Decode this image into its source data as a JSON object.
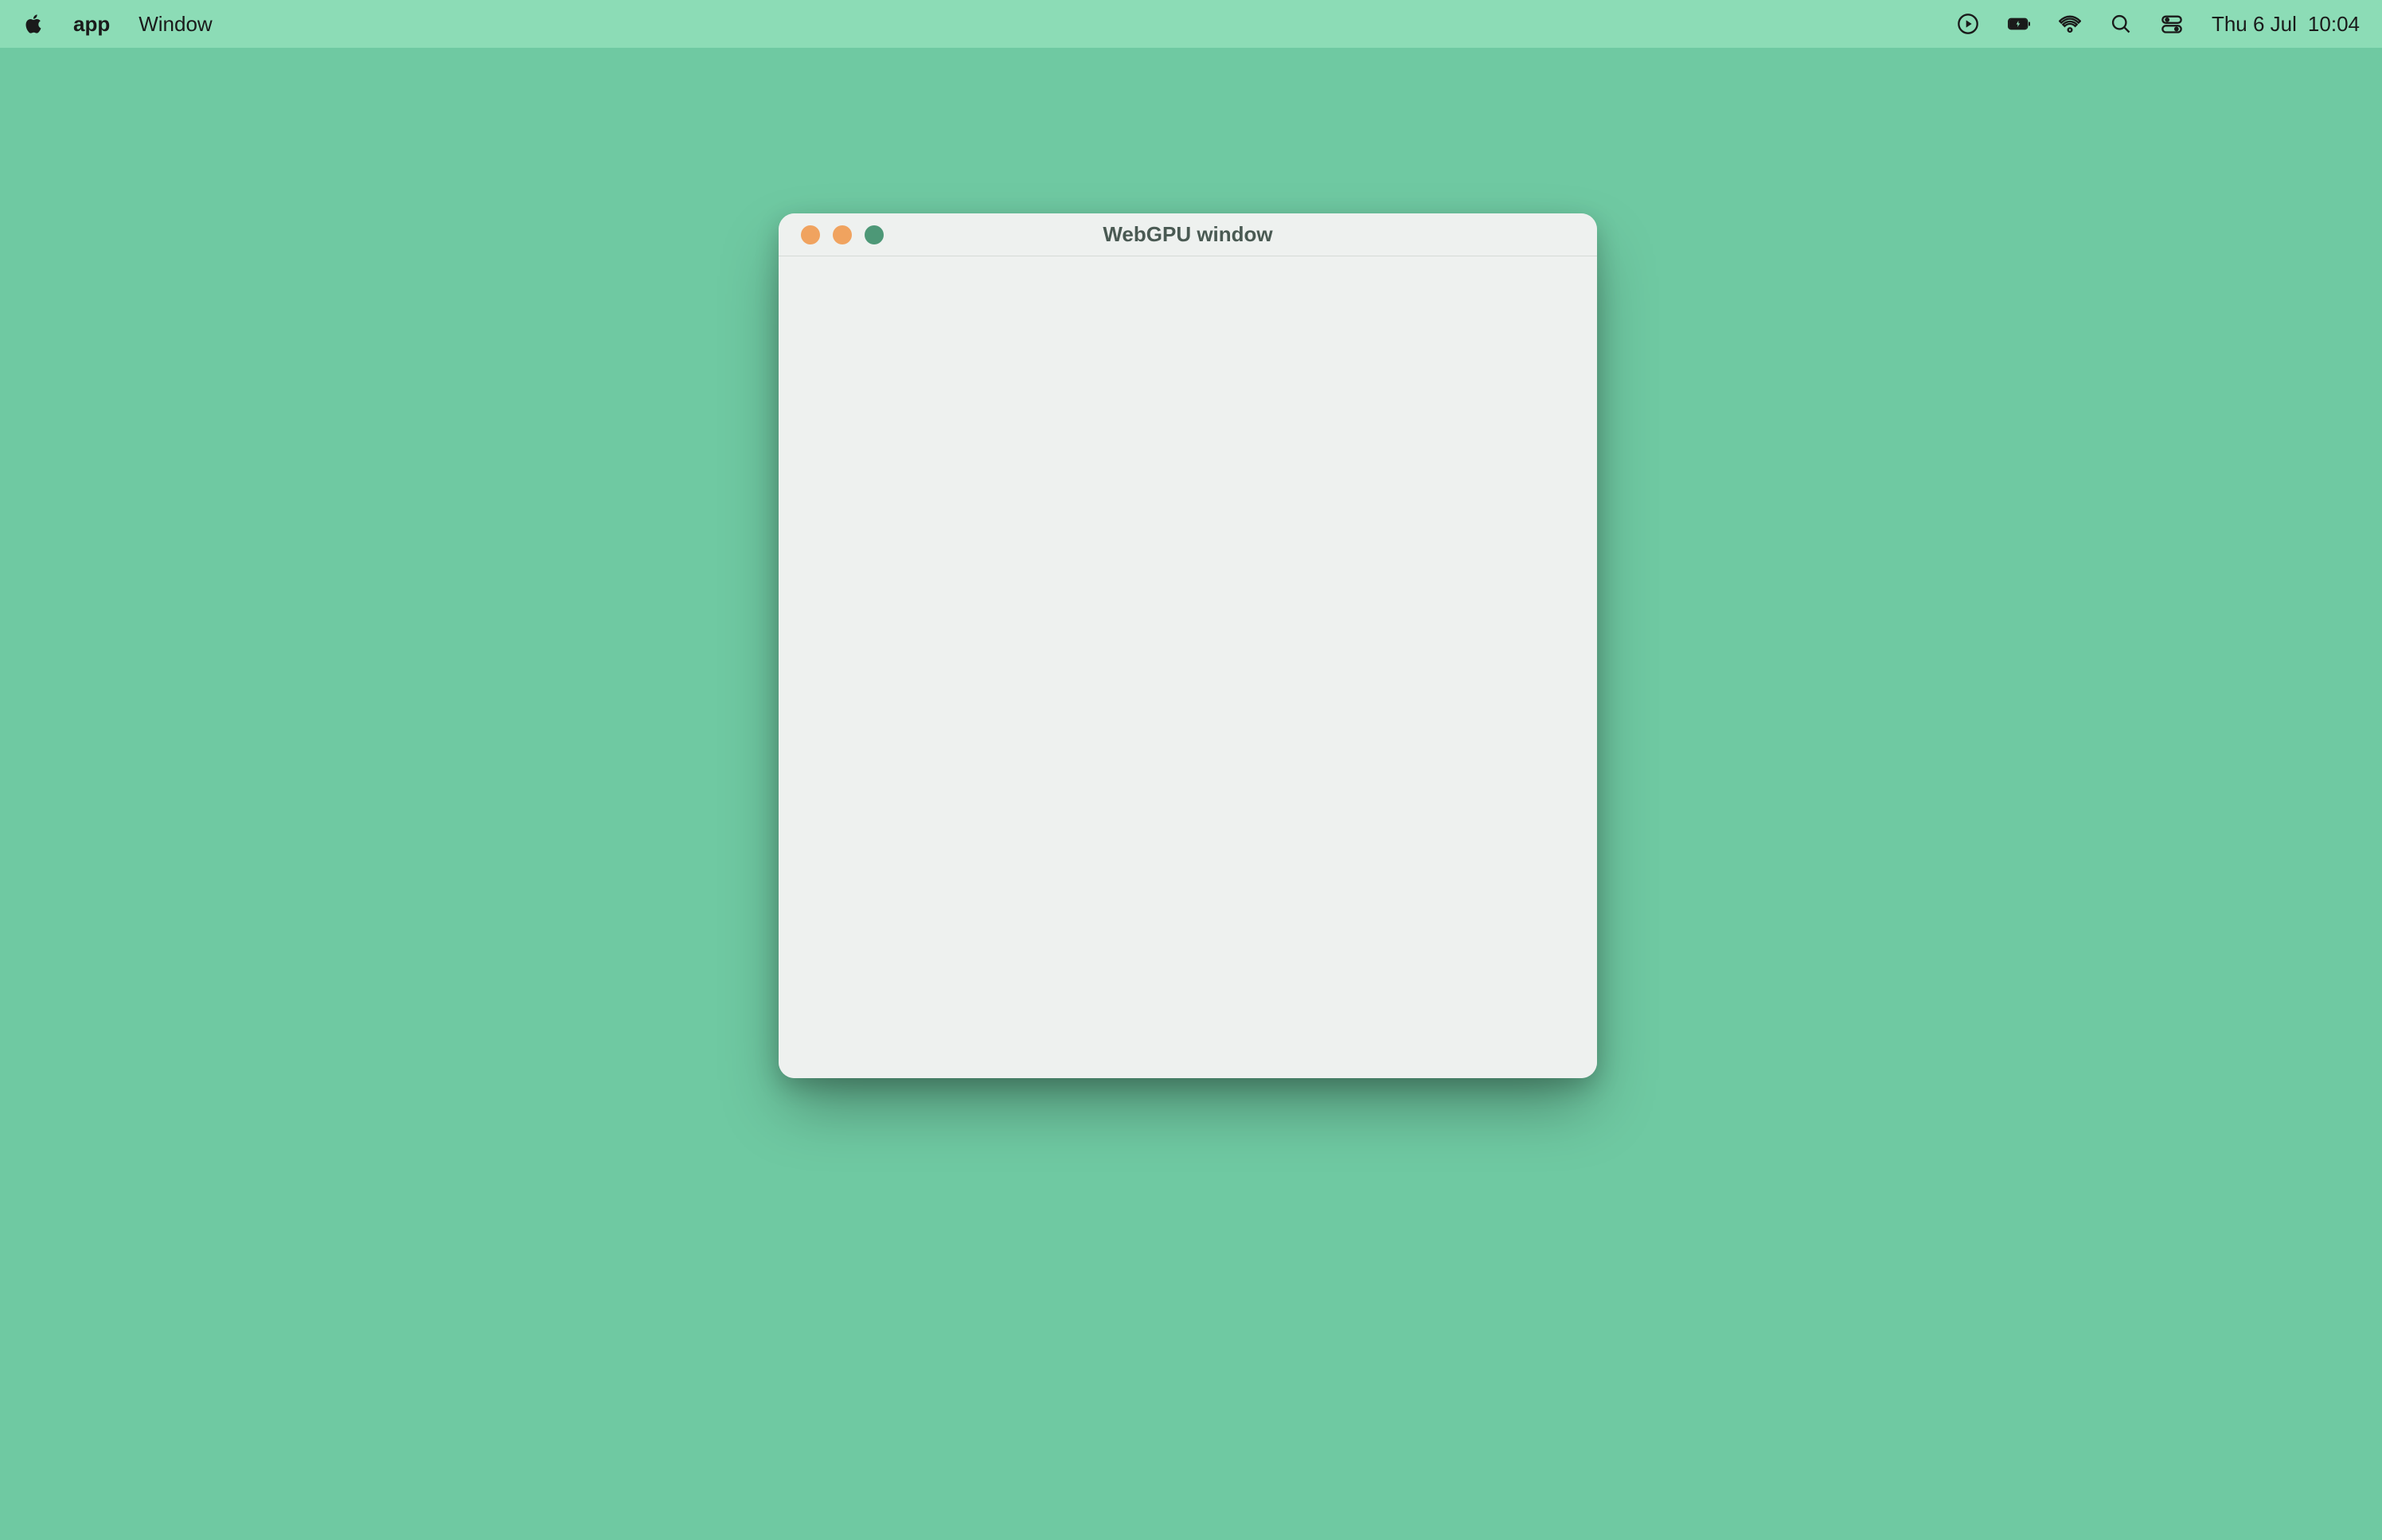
{
  "menu_bar": {
    "app_name": "app",
    "menus": [
      "Window"
    ],
    "date": "Thu 6 Jul",
    "time": "10:04"
  },
  "window": {
    "title": "WebGPU window"
  },
  "colors": {
    "menu_bar_bg": "#8cdcb6",
    "desktop_bg": "#6fc9a2",
    "window_bg": "#eef1ef",
    "traffic_close": "#f0a35f",
    "traffic_minimize": "#f0a35f",
    "traffic_maximize": "#4d9877"
  },
  "icons": {
    "apple": "apple-logo",
    "play": "play-circle-icon",
    "battery": "battery-charging-icon",
    "wifi": "wifi-icon",
    "search": "search-icon",
    "control_center": "control-center-icon"
  }
}
